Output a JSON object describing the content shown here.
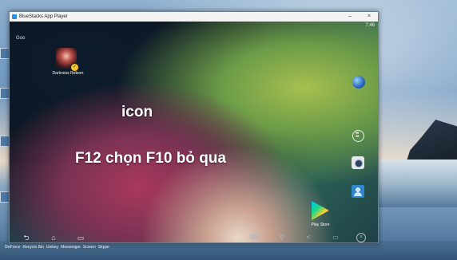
{
  "window": {
    "title": "BlueStacks App Player",
    "minimize_glyph": "–",
    "close_glyph": "×"
  },
  "android": {
    "time": "7:46",
    "search_label": "Goo",
    "app": {
      "label": "Darkness Reborn",
      "icon": "darkness-reborn-icon"
    },
    "overlay": {
      "line1": "icon",
      "line2": "F12 chọn F10 bỏ qua"
    },
    "dock": {
      "icons": [
        "browser-globe-icon",
        "app-drawer-icon",
        "camera-icon",
        "contacts-icon"
      ],
      "play_store_label": "Play Store"
    },
    "navbar": {
      "back_glyph": "⮌",
      "home_glyph": "⌂",
      "recent_glyph": "▭",
      "keyboard_glyph": "⌨",
      "location_glyph": "⚲",
      "share_glyph": "<",
      "screen_glyph": "▭",
      "close_glyph": "×"
    }
  },
  "desktop": {
    "taskbar_labels": [
      "GeForce",
      "Recycle Bin",
      "Unikey",
      "Messenger",
      "Screen",
      "Skype"
    ]
  }
}
